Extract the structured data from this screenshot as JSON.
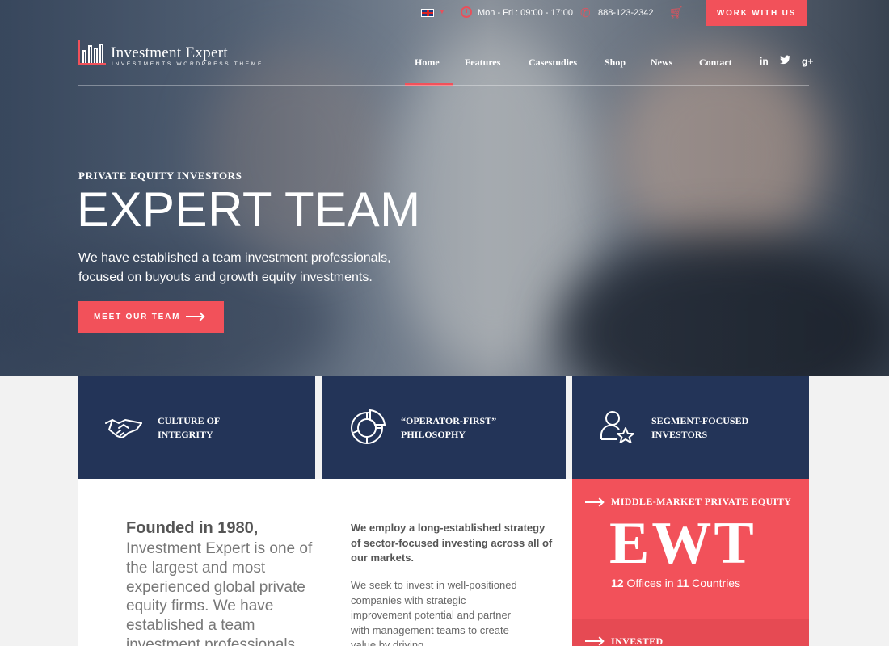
{
  "topbar": {
    "language_flag": "uk-flag-icon",
    "hours": "Mon - Fri : 09:00 - 17:00",
    "phone": "888-123-2342",
    "work_button": "WORK WITH US"
  },
  "brand": {
    "title": "Investment Expert",
    "subtitle": "INVESTMENTS WORDPRESS THEME"
  },
  "nav": {
    "items": [
      {
        "label": "Home",
        "active": true
      },
      {
        "label": "Features"
      },
      {
        "label": "Casestudies"
      },
      {
        "label": "Shop"
      },
      {
        "label": "News"
      },
      {
        "label": "Contact"
      }
    ],
    "social": [
      "in",
      "twitter-icon",
      "g+"
    ]
  },
  "hero": {
    "kicker": "PRIVATE EQUITY INVESTORS",
    "title": "EXPERT TEAM",
    "text_line1": "We have established a team investment professionals,",
    "text_line2": "focused on buyouts and growth equity investments.",
    "cta": "MEET OUR TEAM"
  },
  "features": [
    {
      "icon": "handshake-icon",
      "line1": "Culture of",
      "line2": "Integrity"
    },
    {
      "icon": "pie-chart-icon",
      "line1": "“Operator-First”",
      "line2": "Philosophy"
    },
    {
      "icon": "user-star-icon",
      "line1": "Segment-Focused",
      "line2": "Investors"
    }
  ],
  "content": {
    "intro_bold": "Founded in 1980,",
    "intro_text": "Investment Expert is one of the largest and most experienced global private equity firms. We have established a team investment professionals,",
    "col2_bold": "We employ a long-established strategy of sector-focused investing across all of our markets.",
    "col2_text": "We seek to invest in well-positioned companies with strategic improvement potential and partner with management teams to create value by driving"
  },
  "stat": {
    "kicker": "MIDDLE-MARKET PRIVATE EQUITY",
    "big": "EWT",
    "offices_num": "12",
    "offices_label": "Offices in",
    "countries_num": "11",
    "countries_label": "Countries",
    "kicker2": "INVESTED"
  },
  "colors": {
    "accent": "#f2515a",
    "navy": "#233458"
  }
}
